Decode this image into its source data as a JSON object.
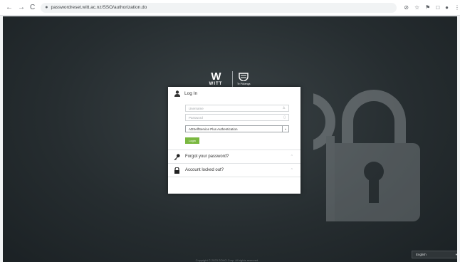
{
  "browser": {
    "back_glyph": "←",
    "forward_glyph": "→",
    "reload_glyph": "C",
    "url": "passwordreset.witt.ac.nz/SSO/authorization.do",
    "extension_glyphs": [
      "⊘",
      "☆",
      "⚑",
      "□",
      "●",
      "⋮"
    ]
  },
  "logo": {
    "witt_mark": "W",
    "witt_word": "WITT",
    "partner_word": "Te Pūkenga"
  },
  "login": {
    "title": "Log In",
    "username_placeholder": "Username",
    "password_placeholder": "Password",
    "auth_method": "ADSelfService Plus Authentication",
    "login_button": "Login"
  },
  "links": {
    "forgot_password": "Forgot your password?",
    "account_locked": "Account locked out?",
    "chevron": "^"
  },
  "footer": {
    "copyright": "Copyright © 2023 ZOHO Corp. All rights reserved."
  },
  "language": {
    "selected": "English",
    "chevron": "▾"
  },
  "colors": {
    "accent_green": "#7ab840",
    "background_dark": "#262d30"
  }
}
